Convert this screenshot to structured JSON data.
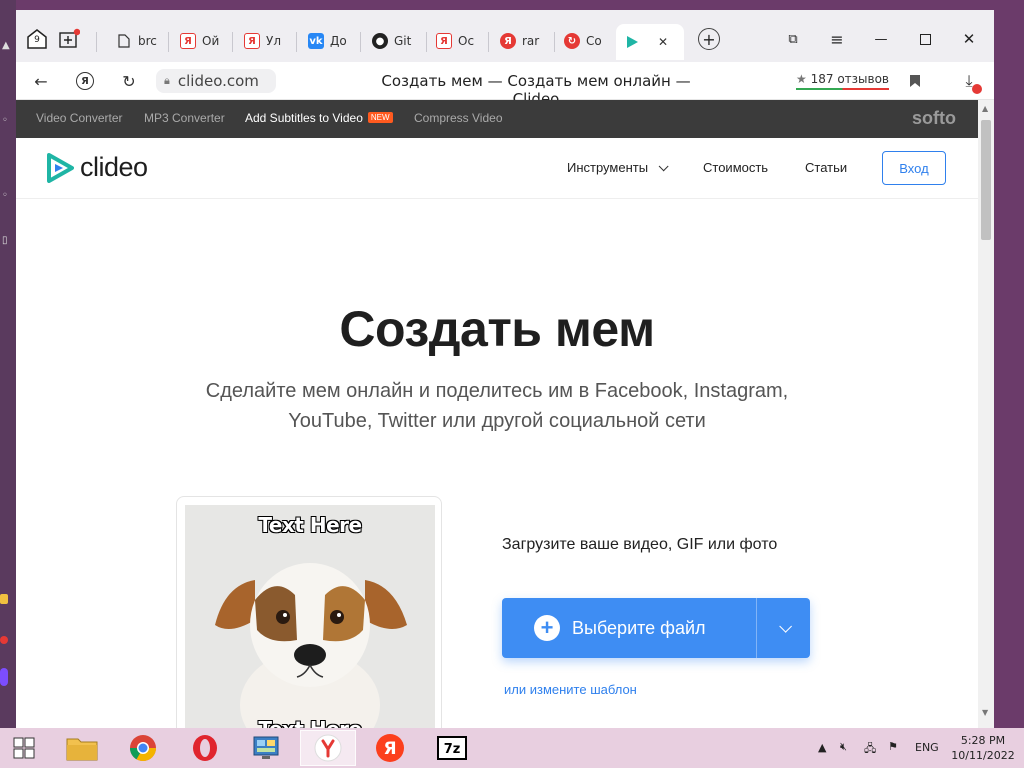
{
  "tabs": [
    {
      "label": "brc",
      "favicon": "doc"
    },
    {
      "label": "Ой",
      "favicon": "yandex"
    },
    {
      "label": "Ул",
      "favicon": "yandex"
    },
    {
      "label": "До",
      "favicon": "vk"
    },
    {
      "label": "Git",
      "favicon": "github"
    },
    {
      "label": "Ос",
      "favicon": "yandex"
    },
    {
      "label": "rar",
      "favicon": "yandex-circle"
    },
    {
      "label": "Со",
      "favicon": "opera-red"
    }
  ],
  "active_tab_favicon": "clideo-play",
  "home_tab_count": "9",
  "address": {
    "url": "clideo.com",
    "page_title": "Создать мем — Создать мем онлайн — Clideo",
    "reviews": "187 отзывов"
  },
  "softo_bar": {
    "links": [
      "Video Converter",
      "MP3 Converter",
      "Add Subtitles to Video",
      "Compress Video"
    ],
    "new_badge": "NEW",
    "brand": "softo"
  },
  "site_header": {
    "logo": "clideo",
    "nav": [
      "Инструменты",
      "Стоимость",
      "Статьи"
    ],
    "login": "Вход"
  },
  "hero": {
    "title": "Создать мем",
    "subtitle_line1": "Сделайте мем онлайн и поделитесь им в Facebook, Instagram,",
    "subtitle_line2": "YouTube, Twitter или другой социальной сети"
  },
  "preview": {
    "top_text": "Text Here",
    "bottom_text": "Text Here"
  },
  "upload": {
    "label": "Загрузите ваше видео, GIF или фото",
    "button": "Выберите файл",
    "template_link": "или измените шаблон"
  },
  "taskbar": {
    "lang": "ENG",
    "time": "5:28 PM",
    "date": "10/11/2022"
  },
  "colors": {
    "accent": "#3e8df3",
    "softo_bg": "#3b3b3b",
    "logo_teal": "#1fb5a5",
    "new_badge": "#ff5a1f",
    "desktop": "#6b3b6a"
  }
}
